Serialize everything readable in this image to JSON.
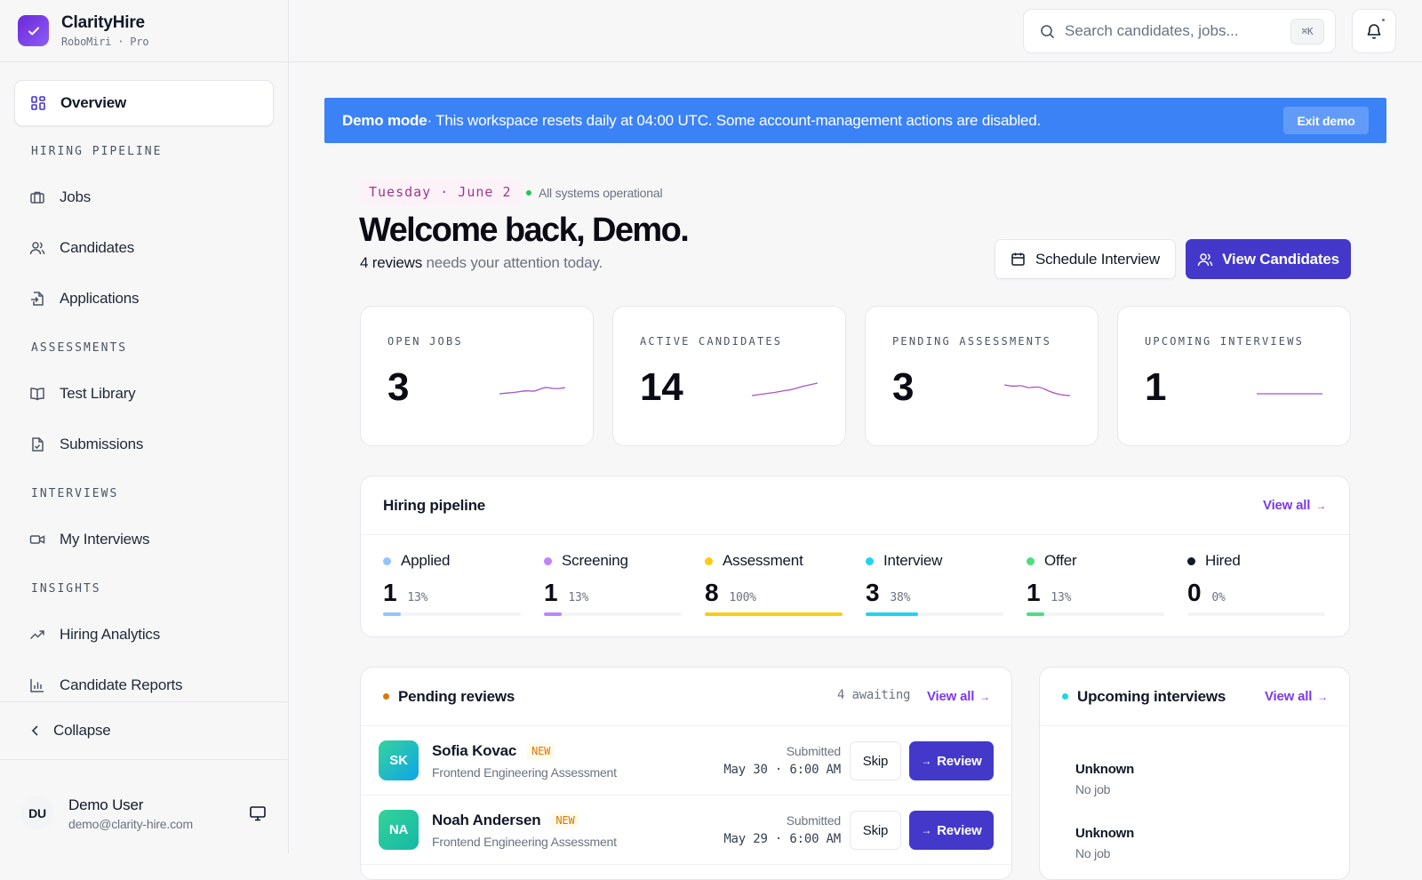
{
  "brand": {
    "name": "ClarityHire",
    "sub": "RoboMiri · Pro"
  },
  "sidebar": {
    "overview": "Overview",
    "sections": {
      "pipeline": "HIRING PIPELINE",
      "assessments": "ASSESSMENTS",
      "interviews": "INTERVIEWS",
      "insights": "INSIGHTS"
    },
    "items": {
      "jobs": "Jobs",
      "candidates": "Candidates",
      "applications": "Applications",
      "test_library": "Test Library",
      "submissions": "Submissions",
      "my_interviews": "My Interviews",
      "hiring_analytics": "Hiring Analytics",
      "candidate_reports": "Candidate Reports"
    },
    "collapse": "Collapse",
    "user": {
      "initials": "DU",
      "name": "Demo User",
      "email": "demo@clarity-hire.com"
    }
  },
  "topbar": {
    "search_placeholder": "Search candidates, jobs...",
    "shortcut": "⌘K"
  },
  "banner": {
    "strong": "Demo mode",
    "text": " · This workspace resets daily at 04:00 UTC. Some account-management actions are disabled.",
    "exit": "Exit demo"
  },
  "header": {
    "date": "Tuesday · June 2",
    "status": "All systems operational",
    "welcome": "Welcome back, Demo.",
    "attention_strong": "4 reviews",
    "attention_rest": " needs your attention today.",
    "schedule_btn": "Schedule Interview",
    "view_btn": "View Candidates"
  },
  "stats": [
    {
      "label": "OPEN JOBS",
      "value": "3"
    },
    {
      "label": "ACTIVE CANDIDATES",
      "value": "14"
    },
    {
      "label": "PENDING ASSESSMENTS",
      "value": "3"
    },
    {
      "label": "UPCOMING INTERVIEWS",
      "value": "1"
    }
  ],
  "pipeline": {
    "title": "Hiring pipeline",
    "view_all": "View all",
    "stages": [
      {
        "name": "Applied",
        "count": "1",
        "pct": "13%",
        "fill": 0.13,
        "color": "#93c5fd"
      },
      {
        "name": "Screening",
        "count": "1",
        "pct": "13%",
        "fill": 0.13,
        "color": "#c084fc"
      },
      {
        "name": "Assessment",
        "count": "8",
        "pct": "100%",
        "fill": 1.0,
        "color": "#facc15"
      },
      {
        "name": "Interview",
        "count": "3",
        "pct": "38%",
        "fill": 0.38,
        "color": "#22d3ee"
      },
      {
        "name": "Offer",
        "count": "1",
        "pct": "13%",
        "fill": 0.13,
        "color": "#4ade80"
      },
      {
        "name": "Hired",
        "count": "0",
        "pct": "0%",
        "fill": 0.0,
        "color": "#111827"
      }
    ]
  },
  "reviews": {
    "title": "Pending reviews",
    "awaiting": "4 awaiting",
    "view_all": "View all",
    "submitted_label": "Submitted",
    "skip": "Skip",
    "review": "Review",
    "new": "NEW",
    "rows": [
      {
        "initials": "SK",
        "name": "Sofia Kovac",
        "test": "Frontend Engineering Assessment",
        "date": "May 30 · 6:00 AM"
      },
      {
        "initials": "NA",
        "name": "Noah Andersen",
        "test": "Frontend Engineering Assessment",
        "date": "May 29 · 6:00 AM"
      }
    ]
  },
  "upcoming": {
    "title": "Upcoming interviews",
    "view_all": "View all",
    "items": [
      {
        "name": "Unknown",
        "job": "No job"
      },
      {
        "name": "Unknown",
        "job": "No job"
      }
    ]
  }
}
